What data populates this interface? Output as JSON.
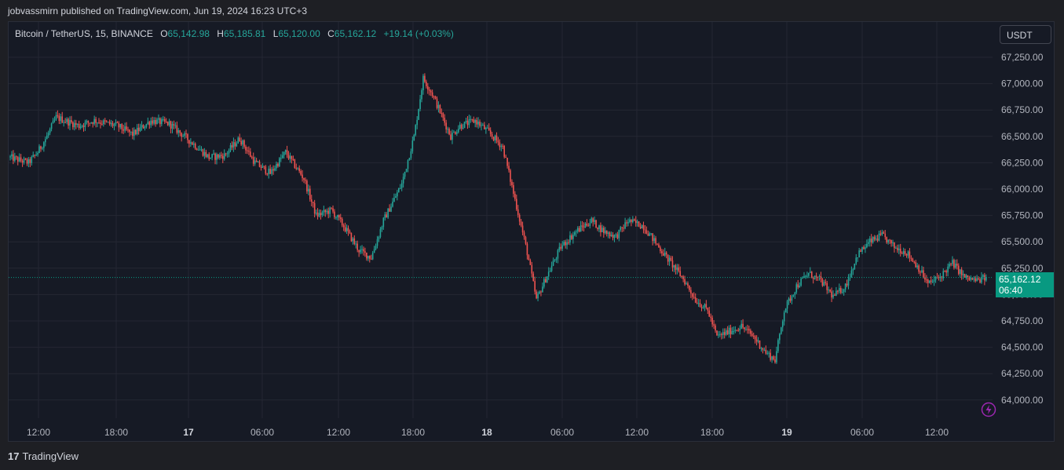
{
  "publish_line": "jobvassmirn published on TradingView.com, Jun 19, 2024 16:23 UTC+3",
  "legend": {
    "symbol": "Bitcoin / TetherUS, 15, BINANCE",
    "open_label": "O",
    "open": "65,142.98",
    "high_label": "H",
    "high": "65,185.81",
    "low_label": "L",
    "low": "65,120.00",
    "close_label": "C",
    "close": "65,162.12",
    "change": "+19.14 (+0.03%)"
  },
  "currency": "USDT",
  "price_tag": {
    "price": "65,162.12",
    "countdown": "06:40"
  },
  "footer": {
    "logo_text": "TradingView",
    "logo_glyph": "17"
  },
  "colors": {
    "up": "#26a69a",
    "down": "#ef5350",
    "bg": "#161a25",
    "grid": "#242733",
    "tag": "#089981"
  },
  "chart_data": {
    "type": "candlestick",
    "y_axis": {
      "ticks": [
        "67,250.00",
        "67,000.00",
        "66,750.00",
        "66,500.00",
        "66,250.00",
        "66,000.00",
        "65,750.00",
        "65,500.00",
        "65,250.00",
        "65,000.00",
        "64,750.00",
        "64,500.00",
        "64,250.00",
        "64,000.00"
      ],
      "tick_values": [
        67250,
        67000,
        66750,
        66500,
        66250,
        66000,
        65750,
        65500,
        65250,
        65000,
        64750,
        64500,
        64250,
        64000
      ],
      "ylim": [
        63950,
        67300
      ]
    },
    "x_axis": {
      "labels": [
        {
          "text": "12:00",
          "bold": false
        },
        {
          "text": "18:00",
          "bold": false
        },
        {
          "text": "17",
          "bold": true
        },
        {
          "text": "06:00",
          "bold": false
        },
        {
          "text": "12:00",
          "bold": false
        },
        {
          "text": "18:00",
          "bold": false
        },
        {
          "text": "18",
          "bold": true
        },
        {
          "text": "06:00",
          "bold": false
        },
        {
          "text": "12:00",
          "bold": false
        },
        {
          "text": "18:00",
          "bold": false
        },
        {
          "text": "19",
          "bold": true
        },
        {
          "text": "06:00",
          "bold": false
        },
        {
          "text": "12:00",
          "bold": false
        }
      ]
    },
    "anchors": [
      [
        0,
        66300
      ],
      [
        12,
        66250
      ],
      [
        18,
        66350
      ],
      [
        24,
        66500
      ],
      [
        30,
        66680
      ],
      [
        45,
        66600
      ],
      [
        55,
        66650
      ],
      [
        70,
        66600
      ],
      [
        80,
        66520
      ],
      [
        92,
        66650
      ],
      [
        104,
        66620
      ],
      [
        118,
        66450
      ],
      [
        130,
        66300
      ],
      [
        140,
        66320
      ],
      [
        150,
        66480
      ],
      [
        160,
        66250
      ],
      [
        170,
        66150
      ],
      [
        180,
        66350
      ],
      [
        192,
        66100
      ],
      [
        200,
        65750
      ],
      [
        210,
        65800
      ],
      [
        218,
        65650
      ],
      [
        228,
        65420
      ],
      [
        236,
        65350
      ],
      [
        244,
        65700
      ],
      [
        256,
        66050
      ],
      [
        264,
        66500
      ],
      [
        270,
        67050
      ],
      [
        276,
        66900
      ],
      [
        282,
        66700
      ],
      [
        288,
        66500
      ],
      [
        294,
        66600
      ],
      [
        304,
        66650
      ],
      [
        312,
        66550
      ],
      [
        322,
        66400
      ],
      [
        330,
        65900
      ],
      [
        338,
        65400
      ],
      [
        344,
        64950
      ],
      [
        350,
        65150
      ],
      [
        360,
        65450
      ],
      [
        370,
        65600
      ],
      [
        380,
        65700
      ],
      [
        388,
        65600
      ],
      [
        396,
        65550
      ],
      [
        404,
        65700
      ],
      [
        414,
        65650
      ],
      [
        424,
        65450
      ],
      [
        432,
        65300
      ],
      [
        440,
        65150
      ],
      [
        448,
        64950
      ],
      [
        456,
        64850
      ],
      [
        462,
        64600
      ],
      [
        470,
        64650
      ],
      [
        478,
        64700
      ],
      [
        486,
        64600
      ],
      [
        494,
        64450
      ],
      [
        500,
        64380
      ],
      [
        506,
        64850
      ],
      [
        514,
        65080
      ],
      [
        522,
        65200
      ],
      [
        530,
        65130
      ],
      [
        538,
        64980
      ],
      [
        546,
        65080
      ],
      [
        554,
        65380
      ],
      [
        562,
        65500
      ],
      [
        570,
        65560
      ],
      [
        578,
        65450
      ],
      [
        586,
        65400
      ],
      [
        594,
        65250
      ],
      [
        600,
        65100
      ],
      [
        608,
        65170
      ],
      [
        616,
        65300
      ],
      [
        624,
        65160
      ],
      [
        632,
        65130
      ],
      [
        638,
        65162.12
      ]
    ]
  }
}
